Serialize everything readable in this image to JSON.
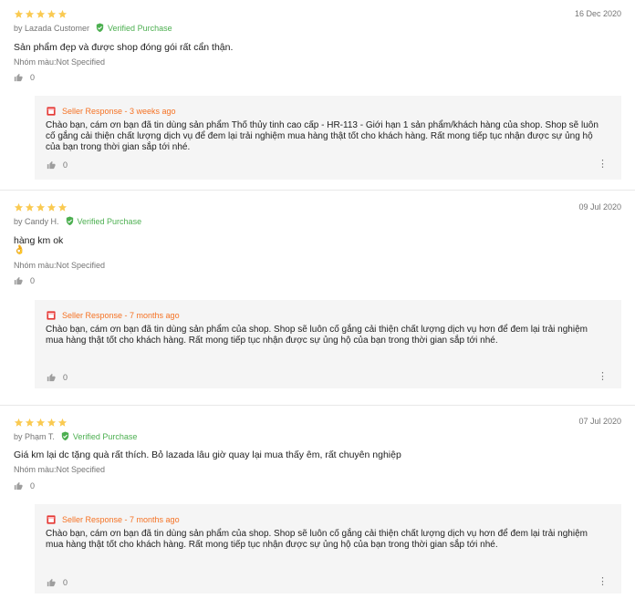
{
  "reviews": [
    {
      "stars": 5,
      "author": "by Lazada Customer",
      "verified": "Verified Purchase",
      "date": "16 Dec 2020",
      "content": "Sản phẩm đẹp và được shop đóng gói rất cẩn thận.",
      "sku": "Nhóm màu:Not Specified",
      "likes": "0",
      "response": {
        "label": "Seller Response - 3 weeks ago",
        "text": "Chào bạn, cám ơn bạn đã tin dùng sản phẩm Thố thủy tinh cao cấp - HR-113 - Giới hạn 1 sản phẩm/khách hàng của shop. Shop sẽ luôn cố gắng cải thiện chất lượng dịch vụ để đem lại trải nghiệm mua hàng thật tốt cho khách hàng. Rất mong tiếp tục nhận được sự ủng hộ của bạn trong thời gian sắp tới nhé.",
        "likes": "0"
      }
    },
    {
      "stars": 5,
      "author": "by Candy H.",
      "verified": "Verified Purchase",
      "date": "09 Jul 2020",
      "content": "hàng km ok",
      "emoji": "👌",
      "sku": "Nhóm màu:Not Specified",
      "likes": "0",
      "response": {
        "label": "Seller Response - 7 months ago",
        "text": "Chào bạn, cám ơn bạn đã tin dùng sản phẩm của shop. Shop sẽ luôn cố gắng cải thiện chất lượng dịch vụ hơn để đem lại trải nghiệm mua hàng thật tốt cho khách hàng. Rất mong tiếp tục nhận được sự ủng hộ của bạn trong thời gian sắp tới nhé.",
        "likes": "0"
      }
    },
    {
      "stars": 5,
      "author": "by Phạm T.",
      "verified": "Verified Purchase",
      "date": "07 Jul 2020",
      "content": "Giá km lại dc tặng quà rất thích. Bỏ lazada lâu giờ quay lại mua thấy êm, rất chuyên nghiệp",
      "sku": "Nhóm màu:Not Specified",
      "likes": "0",
      "response": {
        "label": "Seller Response - 7 months ago",
        "text": "Chào bạn, cám ơn bạn đã tin dùng sản phẩm của shop. Shop sẽ luôn cố gắng cải thiện chất lượng dịch vụ hơn để đem lại trải nghiệm mua hàng thật tốt cho khách hàng. Rất mong tiếp tục nhận được sự ủng hộ của bạn trong thời gian sắp tới nhé.",
        "likes": "0"
      }
    }
  ],
  "colors": {
    "star": "#faca51",
    "verified": "#4caf50",
    "seller_response": "#f57224",
    "response_bg": "#f5f5f5"
  },
  "icons": {
    "star": "star-icon",
    "verified": "verified-check-icon",
    "like": "thumbs-up-icon",
    "shop": "shop-icon",
    "more": "more-vertical-icon"
  }
}
